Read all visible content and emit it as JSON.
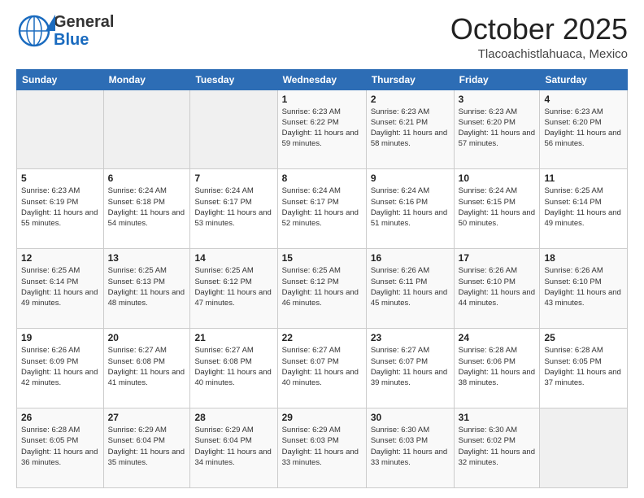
{
  "logo": {
    "line1": "General",
    "line2": "Blue"
  },
  "header": {
    "month": "October 2025",
    "location": "Tlacoachistlahuaca, Mexico"
  },
  "weekdays": [
    "Sunday",
    "Monday",
    "Tuesday",
    "Wednesday",
    "Thursday",
    "Friday",
    "Saturday"
  ],
  "weeks": [
    [
      {
        "day": "",
        "sunrise": "",
        "sunset": "",
        "daylight": ""
      },
      {
        "day": "",
        "sunrise": "",
        "sunset": "",
        "daylight": ""
      },
      {
        "day": "",
        "sunrise": "",
        "sunset": "",
        "daylight": ""
      },
      {
        "day": "1",
        "sunrise": "Sunrise: 6:23 AM",
        "sunset": "Sunset: 6:22 PM",
        "daylight": "Daylight: 11 hours and 59 minutes."
      },
      {
        "day": "2",
        "sunrise": "Sunrise: 6:23 AM",
        "sunset": "Sunset: 6:21 PM",
        "daylight": "Daylight: 11 hours and 58 minutes."
      },
      {
        "day": "3",
        "sunrise": "Sunrise: 6:23 AM",
        "sunset": "Sunset: 6:20 PM",
        "daylight": "Daylight: 11 hours and 57 minutes."
      },
      {
        "day": "4",
        "sunrise": "Sunrise: 6:23 AM",
        "sunset": "Sunset: 6:20 PM",
        "daylight": "Daylight: 11 hours and 56 minutes."
      }
    ],
    [
      {
        "day": "5",
        "sunrise": "Sunrise: 6:23 AM",
        "sunset": "Sunset: 6:19 PM",
        "daylight": "Daylight: 11 hours and 55 minutes."
      },
      {
        "day": "6",
        "sunrise": "Sunrise: 6:24 AM",
        "sunset": "Sunset: 6:18 PM",
        "daylight": "Daylight: 11 hours and 54 minutes."
      },
      {
        "day": "7",
        "sunrise": "Sunrise: 6:24 AM",
        "sunset": "Sunset: 6:17 PM",
        "daylight": "Daylight: 11 hours and 53 minutes."
      },
      {
        "day": "8",
        "sunrise": "Sunrise: 6:24 AM",
        "sunset": "Sunset: 6:17 PM",
        "daylight": "Daylight: 11 hours and 52 minutes."
      },
      {
        "day": "9",
        "sunrise": "Sunrise: 6:24 AM",
        "sunset": "Sunset: 6:16 PM",
        "daylight": "Daylight: 11 hours and 51 minutes."
      },
      {
        "day": "10",
        "sunrise": "Sunrise: 6:24 AM",
        "sunset": "Sunset: 6:15 PM",
        "daylight": "Daylight: 11 hours and 50 minutes."
      },
      {
        "day": "11",
        "sunrise": "Sunrise: 6:25 AM",
        "sunset": "Sunset: 6:14 PM",
        "daylight": "Daylight: 11 hours and 49 minutes."
      }
    ],
    [
      {
        "day": "12",
        "sunrise": "Sunrise: 6:25 AM",
        "sunset": "Sunset: 6:14 PM",
        "daylight": "Daylight: 11 hours and 49 minutes."
      },
      {
        "day": "13",
        "sunrise": "Sunrise: 6:25 AM",
        "sunset": "Sunset: 6:13 PM",
        "daylight": "Daylight: 11 hours and 48 minutes."
      },
      {
        "day": "14",
        "sunrise": "Sunrise: 6:25 AM",
        "sunset": "Sunset: 6:12 PM",
        "daylight": "Daylight: 11 hours and 47 minutes."
      },
      {
        "day": "15",
        "sunrise": "Sunrise: 6:25 AM",
        "sunset": "Sunset: 6:12 PM",
        "daylight": "Daylight: 11 hours and 46 minutes."
      },
      {
        "day": "16",
        "sunrise": "Sunrise: 6:26 AM",
        "sunset": "Sunset: 6:11 PM",
        "daylight": "Daylight: 11 hours and 45 minutes."
      },
      {
        "day": "17",
        "sunrise": "Sunrise: 6:26 AM",
        "sunset": "Sunset: 6:10 PM",
        "daylight": "Daylight: 11 hours and 44 minutes."
      },
      {
        "day": "18",
        "sunrise": "Sunrise: 6:26 AM",
        "sunset": "Sunset: 6:10 PM",
        "daylight": "Daylight: 11 hours and 43 minutes."
      }
    ],
    [
      {
        "day": "19",
        "sunrise": "Sunrise: 6:26 AM",
        "sunset": "Sunset: 6:09 PM",
        "daylight": "Daylight: 11 hours and 42 minutes."
      },
      {
        "day": "20",
        "sunrise": "Sunrise: 6:27 AM",
        "sunset": "Sunset: 6:08 PM",
        "daylight": "Daylight: 11 hours and 41 minutes."
      },
      {
        "day": "21",
        "sunrise": "Sunrise: 6:27 AM",
        "sunset": "Sunset: 6:08 PM",
        "daylight": "Daylight: 11 hours and 40 minutes."
      },
      {
        "day": "22",
        "sunrise": "Sunrise: 6:27 AM",
        "sunset": "Sunset: 6:07 PM",
        "daylight": "Daylight: 11 hours and 40 minutes."
      },
      {
        "day": "23",
        "sunrise": "Sunrise: 6:27 AM",
        "sunset": "Sunset: 6:07 PM",
        "daylight": "Daylight: 11 hours and 39 minutes."
      },
      {
        "day": "24",
        "sunrise": "Sunrise: 6:28 AM",
        "sunset": "Sunset: 6:06 PM",
        "daylight": "Daylight: 11 hours and 38 minutes."
      },
      {
        "day": "25",
        "sunrise": "Sunrise: 6:28 AM",
        "sunset": "Sunset: 6:05 PM",
        "daylight": "Daylight: 11 hours and 37 minutes."
      }
    ],
    [
      {
        "day": "26",
        "sunrise": "Sunrise: 6:28 AM",
        "sunset": "Sunset: 6:05 PM",
        "daylight": "Daylight: 11 hours and 36 minutes."
      },
      {
        "day": "27",
        "sunrise": "Sunrise: 6:29 AM",
        "sunset": "Sunset: 6:04 PM",
        "daylight": "Daylight: 11 hours and 35 minutes."
      },
      {
        "day": "28",
        "sunrise": "Sunrise: 6:29 AM",
        "sunset": "Sunset: 6:04 PM",
        "daylight": "Daylight: 11 hours and 34 minutes."
      },
      {
        "day": "29",
        "sunrise": "Sunrise: 6:29 AM",
        "sunset": "Sunset: 6:03 PM",
        "daylight": "Daylight: 11 hours and 33 minutes."
      },
      {
        "day": "30",
        "sunrise": "Sunrise: 6:30 AM",
        "sunset": "Sunset: 6:03 PM",
        "daylight": "Daylight: 11 hours and 33 minutes."
      },
      {
        "day": "31",
        "sunrise": "Sunrise: 6:30 AM",
        "sunset": "Sunset: 6:02 PM",
        "daylight": "Daylight: 11 hours and 32 minutes."
      },
      {
        "day": "",
        "sunrise": "",
        "sunset": "",
        "daylight": ""
      }
    ]
  ]
}
